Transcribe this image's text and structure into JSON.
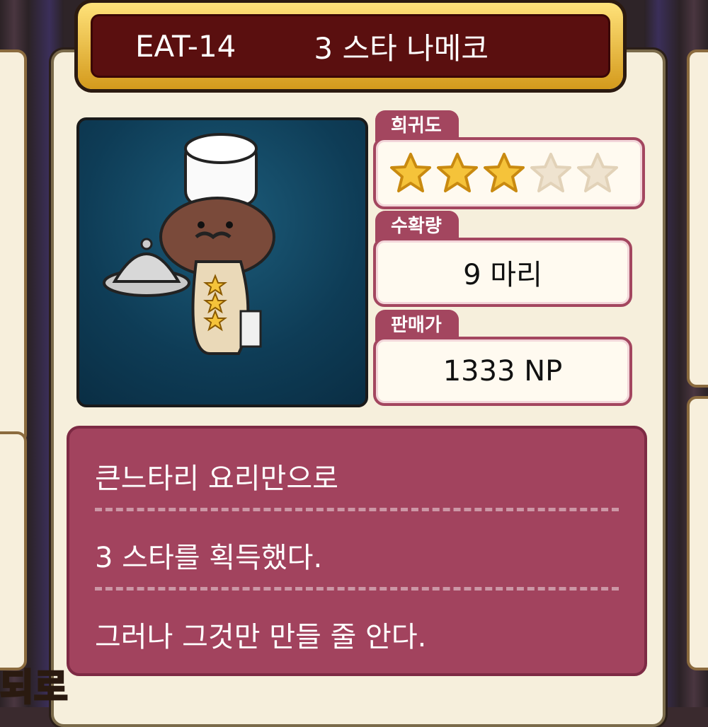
{
  "header": {
    "code": "EAT-14",
    "name": "3 스타 나메코"
  },
  "rarity": {
    "label": "희귀도",
    "stars_filled": 3,
    "stars_total": 5
  },
  "harvest": {
    "label": "수확량",
    "value": "9 마리"
  },
  "price": {
    "label": "판매가",
    "value": "1333 NP"
  },
  "description": {
    "lines": [
      "큰느타리 요리만으로",
      "3 스타를 획득했다.",
      "그러나 그것만 만들 줄 안다."
    ]
  },
  "corner_text": "되로",
  "colors": {
    "accent": "#a3465f",
    "title_bg": "#5a0f0f",
    "gold": "#f5c33a",
    "portrait_bg": "#0e3c56"
  }
}
